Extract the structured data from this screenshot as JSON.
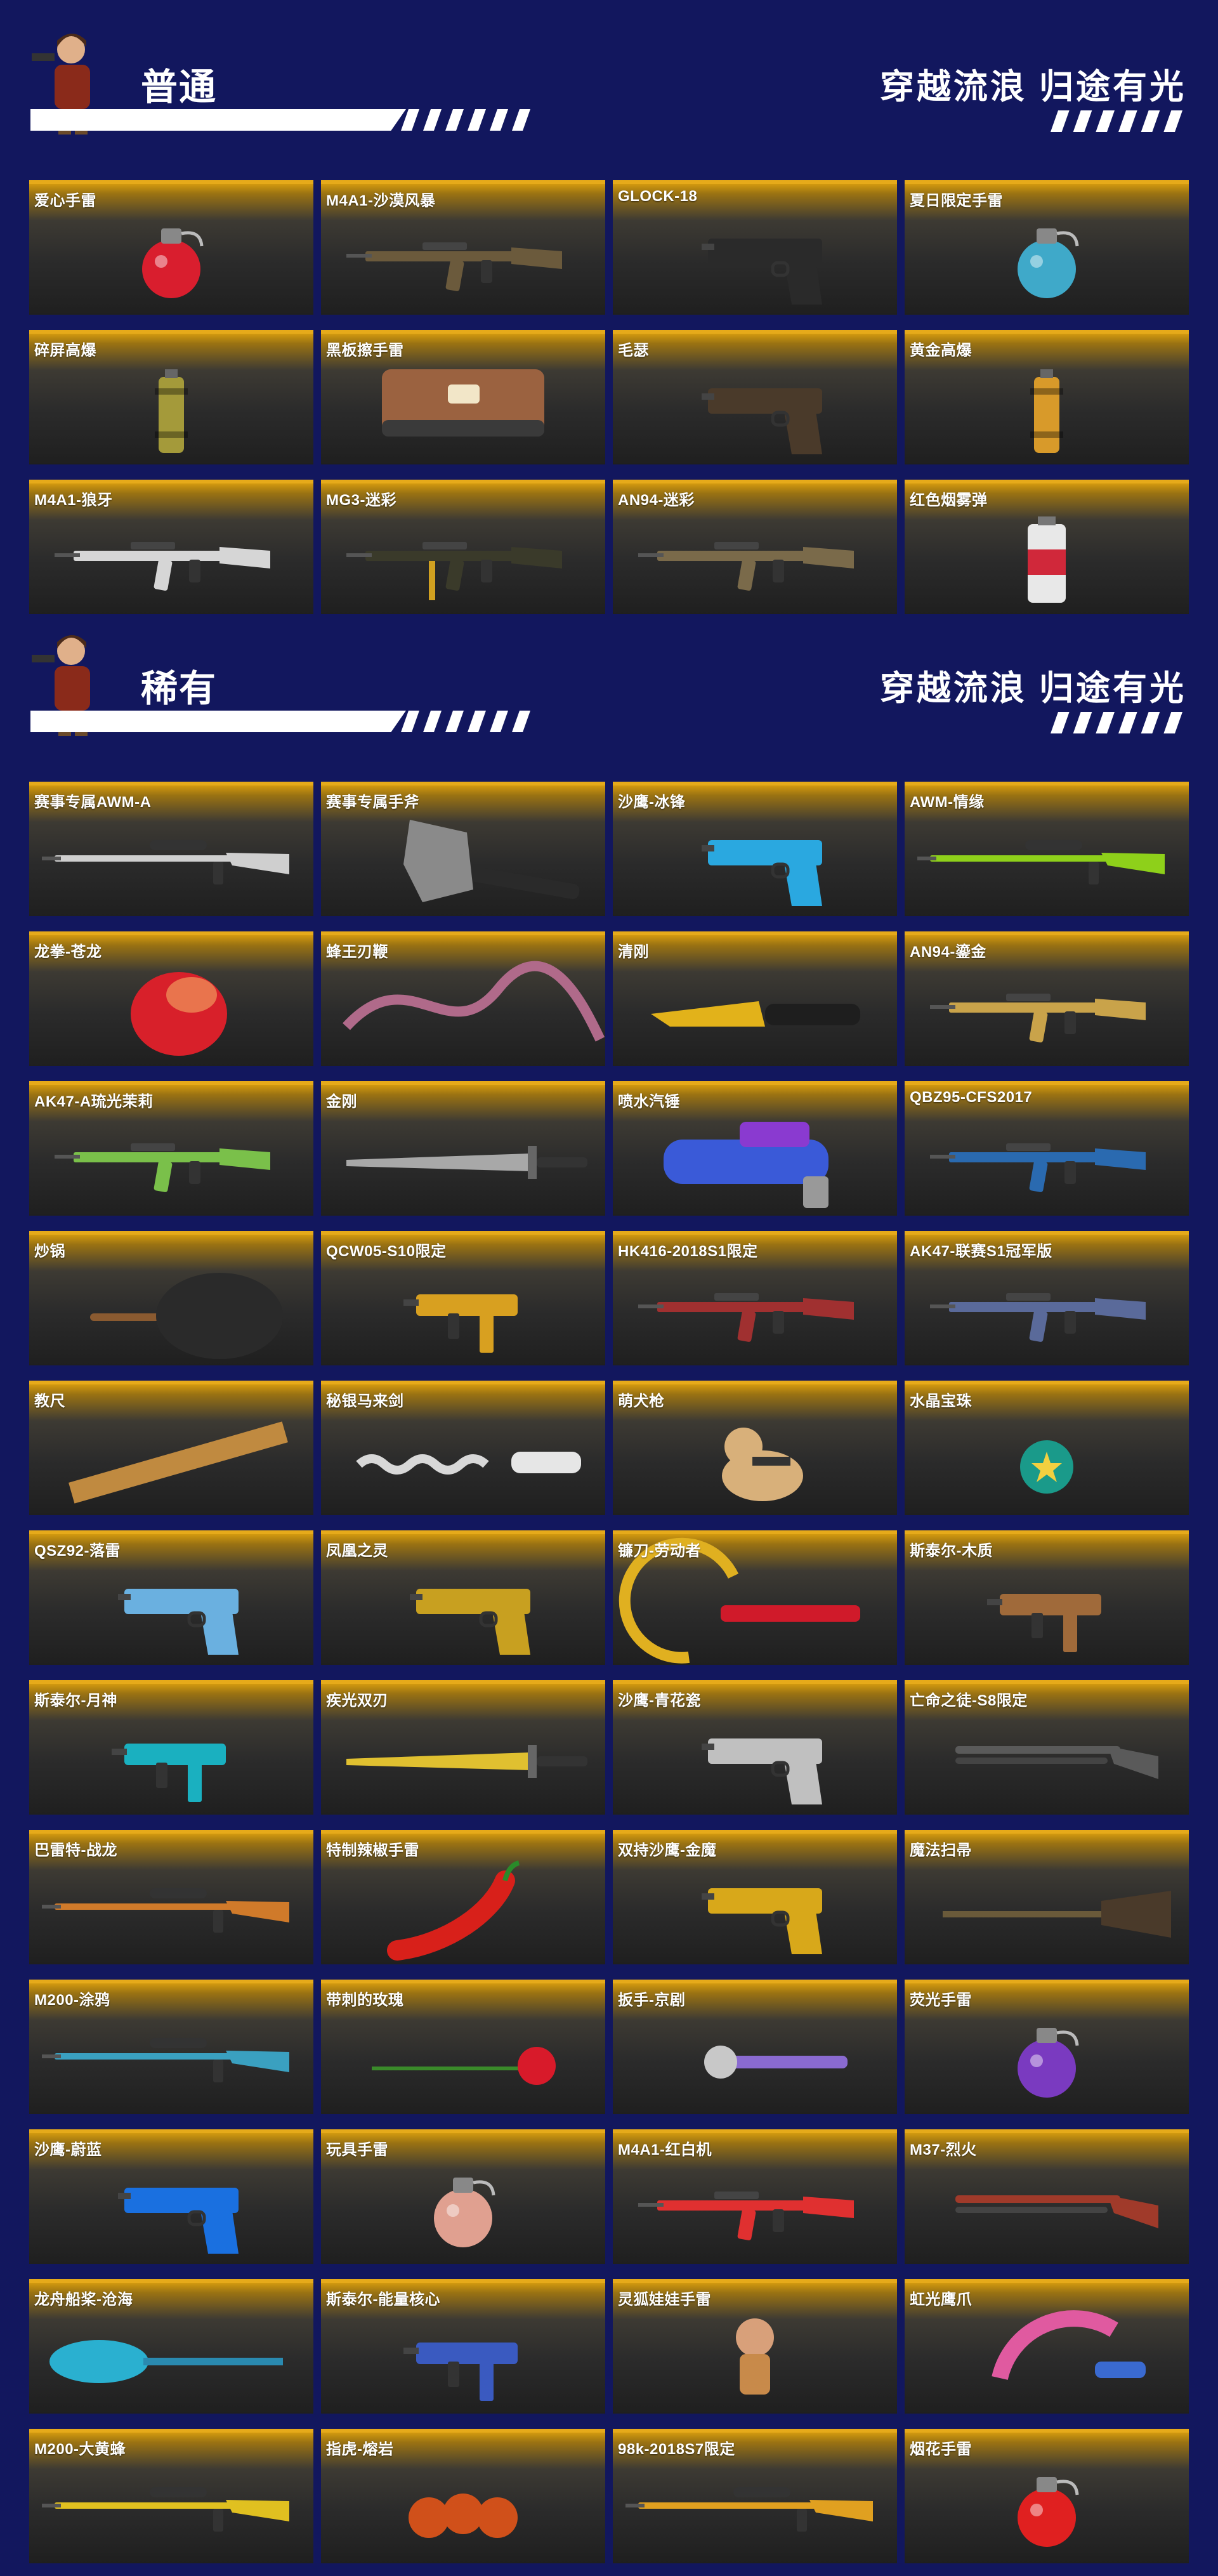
{
  "sections": [
    {
      "title": "普通",
      "slogan": "穿越流浪 归途有光",
      "items": [
        {
          "name": "爱心手雷",
          "icon": "grenade-icon",
          "color": "#d91e2e"
        },
        {
          "name": "M4A1-沙漠风暴",
          "icon": "rifle-icon",
          "color": "#6b5a3c"
        },
        {
          "name": "GLOCK-18",
          "icon": "pistol-icon",
          "color": "#2a2a2a"
        },
        {
          "name": "夏日限定手雷",
          "icon": "grenade-icon",
          "color": "#3fa9c9"
        },
        {
          "name": "碎屏高爆",
          "icon": "canister-icon",
          "color": "#a49a3a"
        },
        {
          "name": "黑板擦手雷",
          "icon": "eraser-icon",
          "color": "#9b6240"
        },
        {
          "name": "毛瑟",
          "icon": "pistol-icon",
          "color": "#4a3a2a"
        },
        {
          "name": "黄金高爆",
          "icon": "canister-icon",
          "color": "#d89a2a"
        },
        {
          "name": "M4A1-狼牙",
          "icon": "rifle-icon",
          "color": "#d6d6d6"
        },
        {
          "name": "MG3-迷彩",
          "icon": "machine-gun-icon",
          "color": "#3a3a2a"
        },
        {
          "name": "AN94-迷彩",
          "icon": "rifle-icon",
          "color": "#7a6a4a"
        },
        {
          "name": "红色烟雾弹",
          "icon": "smoke-canister-icon",
          "color": "#d0283a"
        }
      ]
    },
    {
      "title": "稀有",
      "slogan": "穿越流浪 归途有光",
      "items": [
        {
          "name": "赛事专属AWM-A",
          "icon": "sniper-icon",
          "color": "#cfcfcf"
        },
        {
          "name": "赛事专属手斧",
          "icon": "axe-icon",
          "color": "#8a8a8a"
        },
        {
          "name": "沙鹰-冰锋",
          "icon": "pistol-icon",
          "color": "#2aa8e0"
        },
        {
          "name": "AWM-情缘",
          "icon": "sniper-icon",
          "color": "#8ed01a"
        },
        {
          "name": "龙拳-苍龙",
          "icon": "glove-icon",
          "color": "#d8202a"
        },
        {
          "name": "蜂王刃鞭",
          "icon": "whip-icon",
          "color": "#b06a8a"
        },
        {
          "name": "清刚",
          "icon": "knife-icon",
          "color": "#e2b21a"
        },
        {
          "name": "AN94-鎏金",
          "icon": "rifle-icon",
          "color": "#c9a34a"
        },
        {
          "name": "AK47-A琉光茉莉",
          "icon": "rifle-icon",
          "color": "#7ac04a"
        },
        {
          "name": "金刚",
          "icon": "sword-icon",
          "color": "#a8a8a8"
        },
        {
          "name": "喷水汽锤",
          "icon": "water-gun-icon",
          "color": "#3a5ad8"
        },
        {
          "name": "QBZ95-CFS2017",
          "icon": "rifle-icon",
          "color": "#2a6ab0"
        },
        {
          "name": "炒锅",
          "icon": "wok-icon",
          "color": "#2a2a2a"
        },
        {
          "name": "QCW05-S10限定",
          "icon": "smg-icon",
          "color": "#d8a020"
        },
        {
          "name": "HK416-2018S1限定",
          "icon": "rifle-icon",
          "color": "#a03030"
        },
        {
          "name": "AK47-联赛S1冠军版",
          "icon": "rifle-icon",
          "color": "#5a6a9a"
        },
        {
          "name": "教尺",
          "icon": "ruler-icon",
          "color": "#c08a40"
        },
        {
          "name": "秘银马来剑",
          "icon": "kris-icon",
          "color": "#d8d8d8"
        },
        {
          "name": "萌犬枪",
          "icon": "dog-icon",
          "color": "#d8b07a"
        },
        {
          "name": "水晶宝珠",
          "icon": "orb-icon",
          "color": "#1a9a8a"
        },
        {
          "name": "QSZ92-落雷",
          "icon": "pistol-icon",
          "color": "#6ab0e0"
        },
        {
          "name": "凤凰之灵",
          "icon": "pistol-icon",
          "color": "#c8a020"
        },
        {
          "name": "镰刀-劳动者",
          "icon": "sickle-icon",
          "color": "#e0b020"
        },
        {
          "name": "斯泰尔-木质",
          "icon": "smg-icon",
          "color": "#a06a3a"
        },
        {
          "name": "斯泰尔-月神",
          "icon": "smg-icon",
          "color": "#1ab0c0"
        },
        {
          "name": "疾光双刃",
          "icon": "sword-icon",
          "color": "#e0c030"
        },
        {
          "name": "沙鹰-青花瓷",
          "icon": "pistol-icon",
          "color": "#c0c0c0"
        },
        {
          "name": "亡命之徒-S8限定",
          "icon": "shotgun-icon",
          "color": "#5a5a5a"
        },
        {
          "name": "巴雷特-战龙",
          "icon": "sniper-icon",
          "color": "#d07a2a"
        },
        {
          "name": "特制辣椒手雷",
          "icon": "chili-icon",
          "color": "#d8201a"
        },
        {
          "name": "双持沙鹰-金魔",
          "icon": "pistol-icon",
          "color": "#d8a81a"
        },
        {
          "name": "魔法扫帚",
          "icon": "broom-icon",
          "color": "#6a5a3a"
        },
        {
          "name": "M200-涂鸦",
          "icon": "sniper-icon",
          "color": "#3aa0c0"
        },
        {
          "name": "带刺的玫瑰",
          "icon": "rose-icon",
          "color": "#d81a2a"
        },
        {
          "name": "扳手-京剧",
          "icon": "wrench-icon",
          "color": "#8a6ad0"
        },
        {
          "name": "荧光手雷",
          "icon": "grenade-icon",
          "color": "#7a3ac0"
        },
        {
          "name": "沙鹰-蔚蓝",
          "icon": "pistol-icon",
          "color": "#1a70e0"
        },
        {
          "name": "玩具手雷",
          "icon": "grenade-icon",
          "color": "#e0a090"
        },
        {
          "name": "M4A1-红白机",
          "icon": "rifle-icon",
          "color": "#e03030"
        },
        {
          "name": "M37-烈火",
          "icon": "shotgun-icon",
          "color": "#a03a2a"
        },
        {
          "name": "龙舟船桨-沧海",
          "icon": "paddle-icon",
          "color": "#2ab0d0"
        },
        {
          "name": "斯泰尔-能量核心",
          "icon": "smg-icon",
          "color": "#3a5ac0"
        },
        {
          "name": "灵狐娃娃手雷",
          "icon": "doll-icon",
          "color": "#d8a07a"
        },
        {
          "name": "虹光鹰爪",
          "icon": "karambit-icon",
          "color": "#e05aa0"
        },
        {
          "name": "M200-大黄蜂",
          "icon": "sniper-icon",
          "color": "#e0c020"
        },
        {
          "name": "指虎-熔岩",
          "icon": "knuckles-icon",
          "color": "#d0501a"
        },
        {
          "name": "98k-2018S7限定",
          "icon": "sniper-icon",
          "color": "#e0a020"
        },
        {
          "name": "烟花手雷",
          "icon": "grenade-icon",
          "color": "#e02020"
        }
      ]
    }
  ]
}
